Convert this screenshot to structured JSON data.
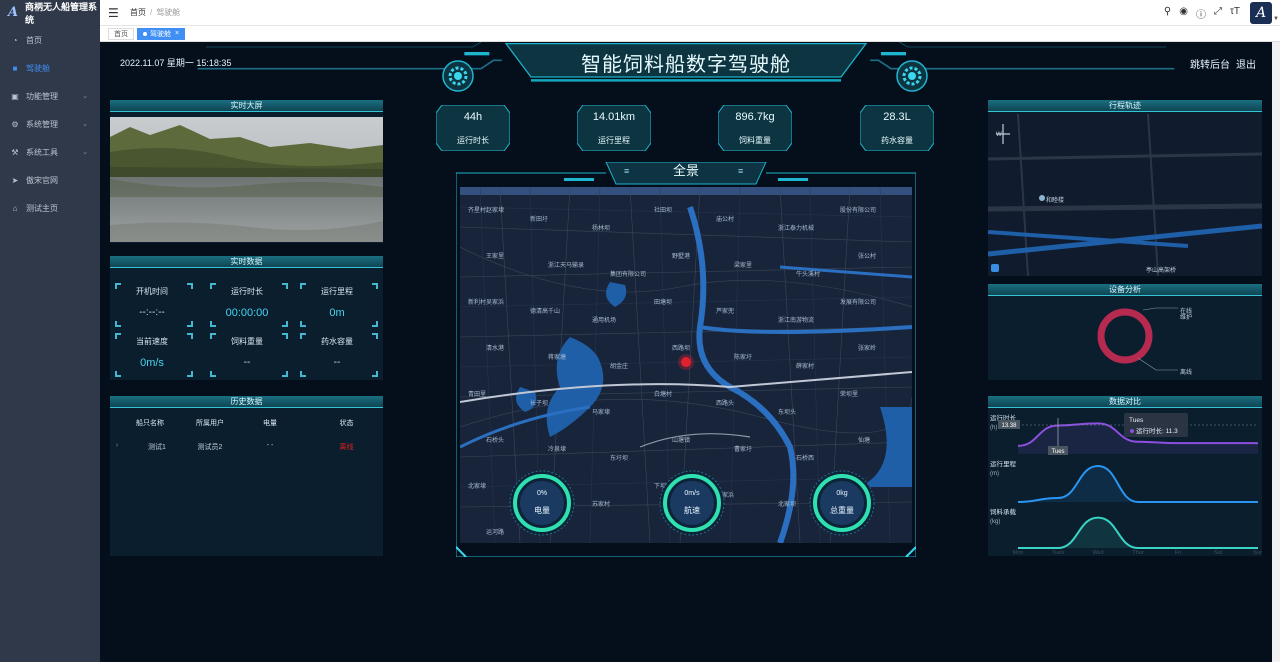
{
  "app": {
    "name": "商柄无人船管理系统"
  },
  "sidebar": {
    "items": [
      {
        "label": "首页",
        "icon": "dashboard-icon",
        "active": false,
        "chevron": false
      },
      {
        "label": "驾驶舱",
        "icon": "cockpit-icon",
        "active": true,
        "chevron": false
      },
      {
        "label": "功能管理",
        "icon": "function-icon",
        "active": false,
        "chevron": true
      },
      {
        "label": "系统管理",
        "icon": "gear-icon",
        "active": false,
        "chevron": true
      },
      {
        "label": "系统工具",
        "icon": "tool-icon",
        "active": false,
        "chevron": true
      },
      {
        "label": "傲宋官网",
        "icon": "send-icon",
        "active": false,
        "chevron": false
      },
      {
        "label": "测试主页",
        "icon": "home-icon",
        "active": false,
        "chevron": false
      }
    ]
  },
  "topbar": {
    "breadcrumb": [
      "首页",
      "驾驶舱"
    ],
    "icons": [
      "search-icon",
      "github-icon",
      "help-icon",
      "fullscreen-icon",
      "font-size-icon"
    ],
    "avatar_letter": "A"
  },
  "tags": [
    {
      "label": "首页",
      "active": false
    },
    {
      "label": "驾驶舱",
      "active": true
    }
  ],
  "header": {
    "datetime": "2022.11.07 星期一 15:18:35",
    "title": "智能饲料船数字驾驶舱",
    "link_backend": "跳转后台",
    "link_exit": "退出"
  },
  "panels": {
    "live_screen": "实时大屏",
    "realtime": {
      "title": "实时数据",
      "cells": [
        {
          "label": "开机时间",
          "value": "--:--:--"
        },
        {
          "label": "运行时长",
          "value": "00:00:00"
        },
        {
          "label": "运行里程",
          "value": "0m"
        },
        {
          "label": "当前速度",
          "value": "0m/s"
        },
        {
          "label": "饲料重量",
          "value": "--"
        },
        {
          "label": "药水容量",
          "value": "--"
        }
      ]
    },
    "history": {
      "title": "历史数据",
      "headers": [
        "船只名称",
        "所属用户",
        "电量",
        "状态"
      ],
      "rows": [
        {
          "name": "测试1",
          "user": "测试员2",
          "power": "- -",
          "status": "离线"
        }
      ]
    },
    "trajectory": {
      "title": "行程轨迹",
      "place_a": "和睦楼",
      "place_b": "亭山高架桥",
      "compass": "W"
    },
    "device": {
      "title": "设备分析",
      "label_online": "在线",
      "label_fault": "维护",
      "label_offline": "离线",
      "offline_ratio": 1.0
    },
    "compare": {
      "title": "数据对比"
    }
  },
  "stats": [
    {
      "value": "44h",
      "label": "运行时长"
    },
    {
      "value": "14.01km",
      "label": "运行里程"
    },
    {
      "value": "896.7kg",
      "label": "饲料重量"
    },
    {
      "value": "28.3L",
      "label": "药水容量"
    }
  ],
  "map": {
    "title": "全景",
    "place_labels": [
      "齐星村赵家埭",
      "新田圩",
      "杨林坝",
      "社田坝",
      "庙公村",
      "浙江泰力机械",
      "股份有限公司",
      "王家里",
      "浙江天马输录",
      "集团有限公司",
      "野墅港",
      "梁家里",
      "牛头溪村",
      "张公村",
      "新利村吴家浜",
      "德清高千山",
      "通用机场",
      "田塘坝",
      "芦家兜",
      "浙江南游物流",
      "发展有限公司",
      "清水港",
      "蒋家塘",
      "胡金庄",
      "西路坝",
      "陈家圩",
      "薛家村",
      "张家岭",
      "青田里",
      "长子坝",
      "马家埭",
      "白塘村",
      "西路头",
      "东坝头",
      "荣坝里",
      "石桥头",
      "冷泉埭",
      "东圩坝",
      "山塘镇",
      "曹家圩",
      "石桥西",
      "仙塘",
      "北家埭",
      "金家埭",
      "苏家村",
      "下坝",
      "宋家浜",
      "北家坝",
      "下渚湖",
      "运河路"
    ],
    "gauges": [
      {
        "value": "0%",
        "label": "电量"
      },
      {
        "value": "0m/s",
        "label": "航速"
      },
      {
        "value": "0kg",
        "label": "总重量"
      }
    ]
  },
  "chart_data": {
    "type": "line",
    "categories": [
      "Mon",
      "Tues",
      "Wed",
      "Thur",
      "Fri",
      "Sat",
      "Sun"
    ],
    "series": [
      {
        "name": "运行时长",
        "unit": "(h)",
        "values": [
          3,
          10.5,
          11.3,
          4.5,
          4,
          4,
          4
        ],
        "color": "#8d4fe0"
      },
      {
        "name": "运行里程",
        "unit": "(m)",
        "values": [
          0,
          1,
          9,
          0,
          0,
          0,
          0
        ],
        "color": "#2a95f2"
      },
      {
        "name": "饲料承载",
        "unit": "(kg)",
        "values": [
          0,
          0,
          8,
          0,
          0,
          0,
          0
        ],
        "color": "#38d4c4"
      }
    ],
    "tooltip": {
      "category": "Tues",
      "text": "运行时长: 11.3"
    },
    "marker_value": "13.38"
  }
}
